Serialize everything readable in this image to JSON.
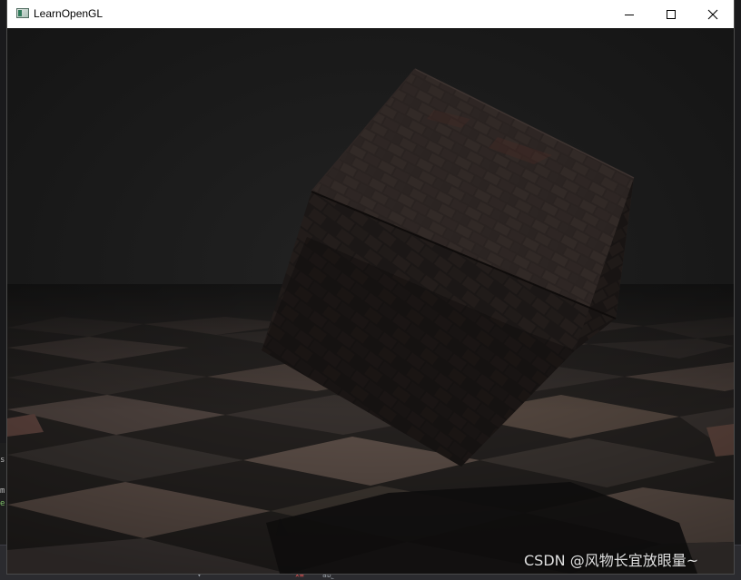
{
  "window": {
    "title": "LearnOpenGL",
    "icon": "opengl-app-icon",
    "controls": {
      "minimize_icon": "minimize-icon",
      "maximize_icon": "maximize-icon",
      "close_icon": "close-icon"
    }
  },
  "scene": {
    "description_icon": "rendered-3d-scene",
    "objects": [
      "floor-tiles",
      "brick-cube",
      "cube-shadow"
    ],
    "colors": {
      "sky": "#1a1a1a",
      "floor_dark": "#2a2624",
      "floor_light": "#6a5a55",
      "cube": "#231e1c"
    }
  },
  "background_app": {
    "taskbar_glyphs": [
      "ab˾",
      "✕≡"
    ]
  },
  "watermark": {
    "text": "CSDN @风物长宜放眼量~"
  }
}
